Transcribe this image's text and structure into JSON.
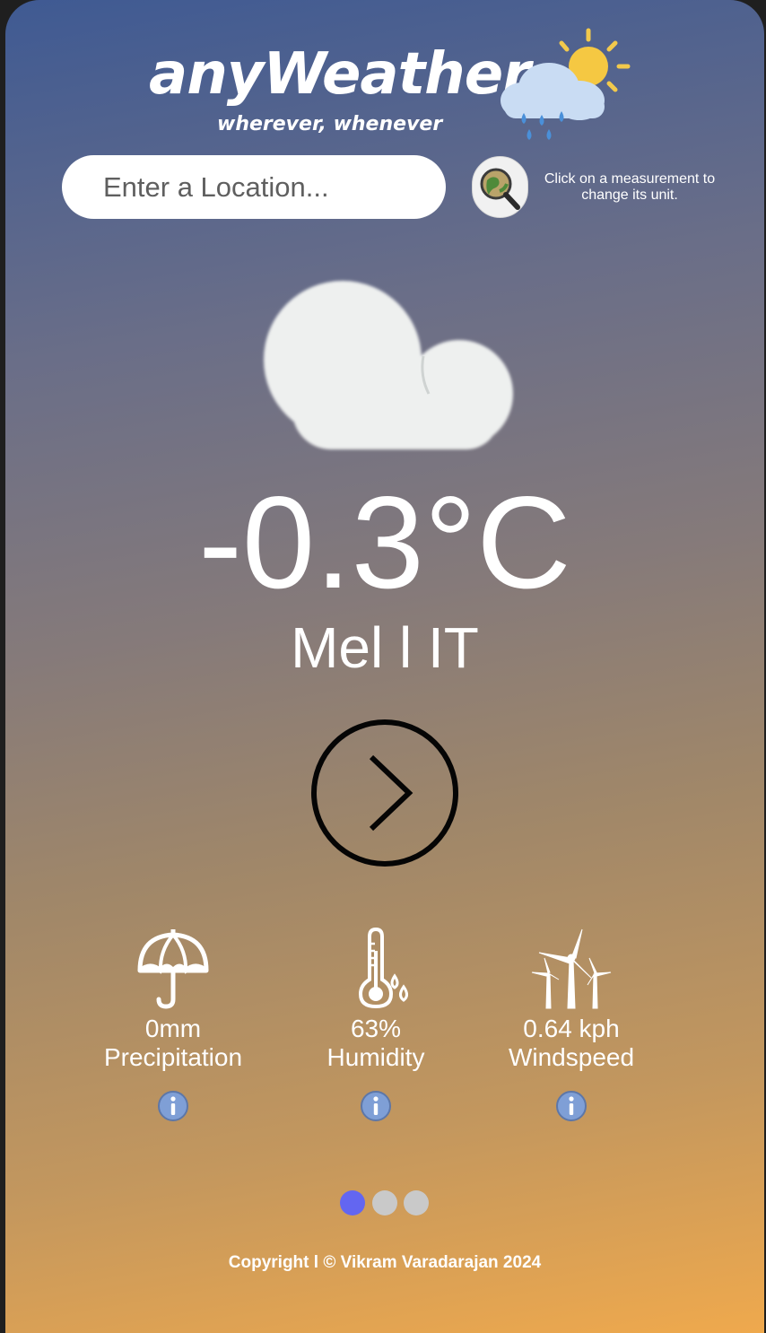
{
  "header": {
    "title": "anyWeather",
    "tagline": "wherever, whenever"
  },
  "search": {
    "placeholder": "Enter a Location...",
    "value": "",
    "hint": "Click on a measurement to change its unit."
  },
  "current": {
    "icon": "cloud-icon",
    "temperature": "-0.3°C",
    "location": "Mel l IT"
  },
  "stats": [
    {
      "icon": "umbrella-icon",
      "value": "0mm",
      "label": "Precipitation"
    },
    {
      "icon": "thermometer-droplets-icon",
      "value": "63%",
      "label": "Humidity"
    },
    {
      "icon": "wind-turbine-icon",
      "value": "0.64 kph",
      "label": "Windspeed"
    }
  ],
  "pager": {
    "pages": 3,
    "active_index": 0
  },
  "footer": {
    "copyright": "Copyright l © Vikram Varadarajan 2024"
  },
  "colors": {
    "gradient_top": "#3f5a93",
    "gradient_bottom": "#efa94d",
    "dot_active": "#6366f1",
    "dot_inactive": "#c9c9c9",
    "info_icon": "#7f9fd6"
  }
}
